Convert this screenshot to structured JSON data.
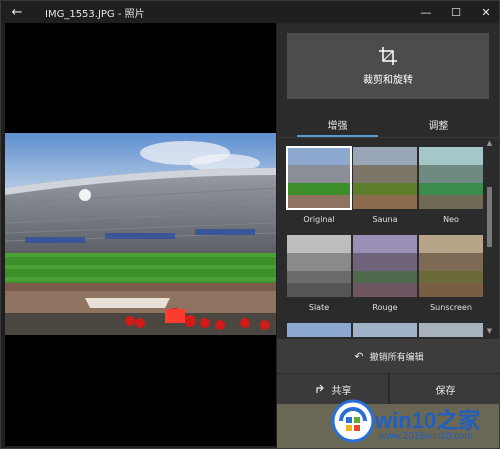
{
  "window": {
    "title": "IMG_1553.JPG - 照片",
    "back_icon": "arrow-left-icon",
    "minimize_icon": "minimize-icon",
    "maximize_icon": "maximize-icon",
    "close_icon": "close-icon"
  },
  "editor": {
    "crop_button_label": "裁剪和旋转",
    "tabs": [
      {
        "label": "增强",
        "active": true
      },
      {
        "label": "调整",
        "active": false
      }
    ],
    "filters": [
      {
        "label": "Original",
        "tone": "natural"
      },
      {
        "label": "Sauna",
        "tone": "warm"
      },
      {
        "label": "Neo",
        "tone": "cool"
      },
      {
        "label": "Slate",
        "tone": "mono"
      },
      {
        "label": "Rouge",
        "tone": "purple"
      },
      {
        "label": "Sunscreen",
        "tone": "sepia"
      },
      {
        "label": "",
        "tone": "natural"
      },
      {
        "label": "",
        "tone": "natural"
      },
      {
        "label": "",
        "tone": "natural"
      }
    ],
    "undo_label": "撤销所有编辑",
    "share_label": "共享",
    "save_label": "保存"
  },
  "watermark": {
    "text_main": "win10之家",
    "text_url": "www.2016win10.com"
  },
  "colors": {
    "accent": "#5a9bd5",
    "panel_bg": "#2b2b2b",
    "button_bg": "#4c4c4c"
  }
}
